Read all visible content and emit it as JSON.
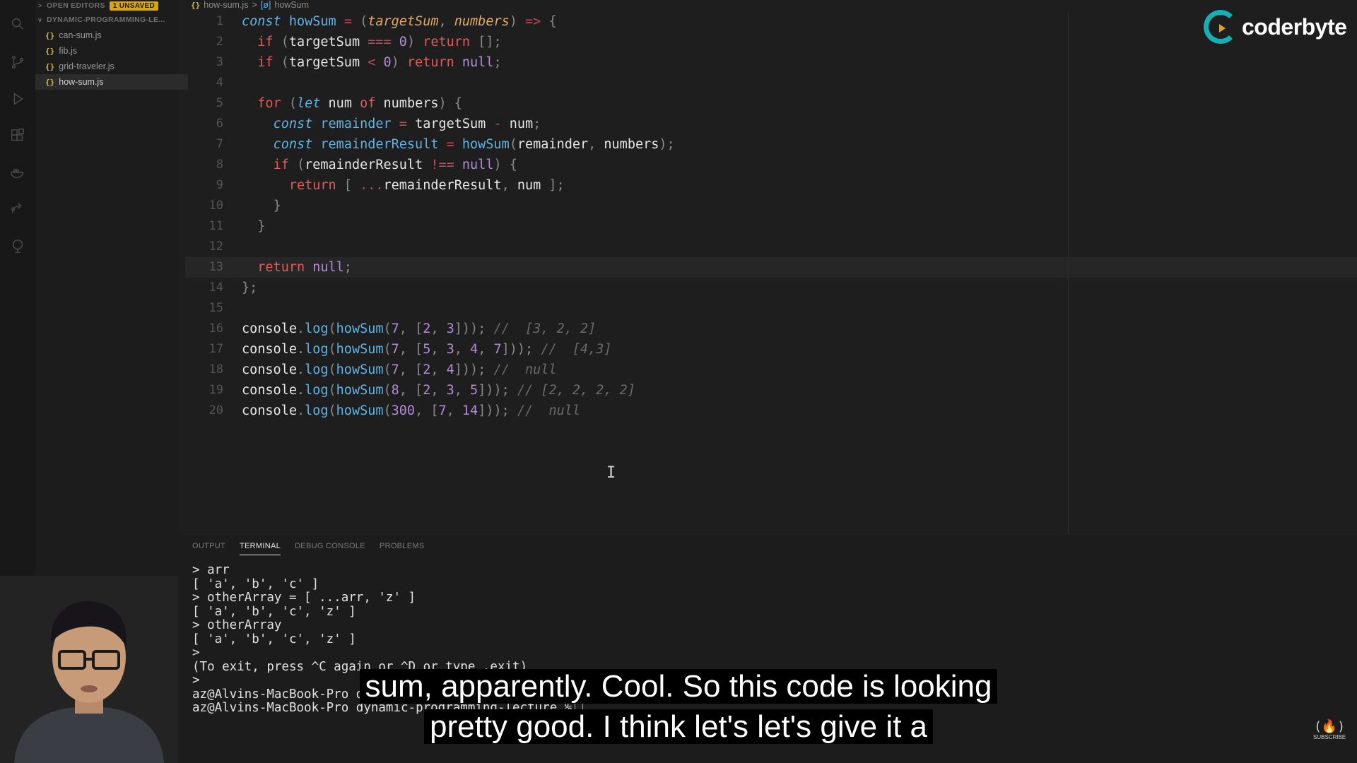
{
  "sidebar": {
    "open_editors_label": "OPEN EDITORS",
    "unsaved_badge": "1 UNSAVED",
    "folder_label": "DYNAMIC-PROGRAMMING-LE...",
    "file_icon": "{}",
    "files": [
      {
        "name": "can-sum.js"
      },
      {
        "name": "fib.js"
      },
      {
        "name": "grid-traveler.js"
      },
      {
        "name": "how-sum.js",
        "active": true
      }
    ]
  },
  "breadcrumb": {
    "file_icon": "{}",
    "file": "how-sum.js",
    "separator": ">",
    "symbol_icon": "[ø]",
    "symbol": "howSum"
  },
  "editor": {
    "current_line": 13,
    "lines": [
      [
        [
          "kw-i",
          "const"
        ],
        [
          "id",
          " "
        ],
        [
          "fn",
          "howSum"
        ],
        [
          "id",
          " "
        ],
        [
          "op",
          "="
        ],
        [
          "id",
          " "
        ],
        [
          "punc",
          "("
        ],
        [
          "param",
          "targetSum"
        ],
        [
          "punc",
          ", "
        ],
        [
          "param",
          "numbers"
        ],
        [
          "punc",
          ")"
        ],
        [
          "id",
          " "
        ],
        [
          "op",
          "=>"
        ],
        [
          "id",
          " "
        ],
        [
          "punc",
          "{"
        ]
      ],
      [
        [
          "id",
          "  "
        ],
        [
          "kw",
          "if"
        ],
        [
          "id",
          " "
        ],
        [
          "punc",
          "("
        ],
        [
          "id",
          "targetSum "
        ],
        [
          "op",
          "==="
        ],
        [
          "id",
          " "
        ],
        [
          "num",
          "0"
        ],
        [
          "punc",
          ")"
        ],
        [
          "id",
          " "
        ],
        [
          "kw",
          "return"
        ],
        [
          "id",
          " "
        ],
        [
          "punc",
          "[];"
        ]
      ],
      [
        [
          "id",
          "  "
        ],
        [
          "kw",
          "if"
        ],
        [
          "id",
          " "
        ],
        [
          "punc",
          "("
        ],
        [
          "id",
          "targetSum "
        ],
        [
          "op",
          "<"
        ],
        [
          "id",
          " "
        ],
        [
          "num",
          "0"
        ],
        [
          "punc",
          ")"
        ],
        [
          "id",
          " "
        ],
        [
          "kw",
          "return"
        ],
        [
          "id",
          " "
        ],
        [
          "lit",
          "null"
        ],
        [
          "punc",
          ";"
        ]
      ],
      [],
      [
        [
          "id",
          "  "
        ],
        [
          "kw",
          "for"
        ],
        [
          "id",
          " "
        ],
        [
          "punc",
          "("
        ],
        [
          "kw-i",
          "let"
        ],
        [
          "id",
          " num "
        ],
        [
          "kw",
          "of"
        ],
        [
          "id",
          " numbers"
        ],
        [
          "punc",
          ")"
        ],
        [
          "id",
          " "
        ],
        [
          "punc",
          "{"
        ]
      ],
      [
        [
          "id",
          "    "
        ],
        [
          "kw-i",
          "const"
        ],
        [
          "id",
          " "
        ],
        [
          "fn",
          "remainder"
        ],
        [
          "id",
          " "
        ],
        [
          "op",
          "="
        ],
        [
          "id",
          " targetSum "
        ],
        [
          "op",
          "-"
        ],
        [
          "id",
          " num"
        ],
        [
          "punc",
          ";"
        ]
      ],
      [
        [
          "id",
          "    "
        ],
        [
          "kw-i",
          "const"
        ],
        [
          "id",
          " "
        ],
        [
          "fn",
          "remainderResult"
        ],
        [
          "id",
          " "
        ],
        [
          "op",
          "="
        ],
        [
          "id",
          " "
        ],
        [
          "fn",
          "howSum"
        ],
        [
          "punc",
          "("
        ],
        [
          "id",
          "remainder"
        ],
        [
          "punc",
          ", "
        ],
        [
          "id",
          "numbers"
        ],
        [
          "punc",
          ");"
        ]
      ],
      [
        [
          "id",
          "    "
        ],
        [
          "kw",
          "if"
        ],
        [
          "id",
          " "
        ],
        [
          "punc",
          "("
        ],
        [
          "id",
          "remainderResult "
        ],
        [
          "op",
          "!=="
        ],
        [
          "id",
          " "
        ],
        [
          "lit",
          "null"
        ],
        [
          "punc",
          ")"
        ],
        [
          "id",
          " "
        ],
        [
          "punc",
          "{"
        ]
      ],
      [
        [
          "id",
          "      "
        ],
        [
          "kw",
          "return"
        ],
        [
          "id",
          " "
        ],
        [
          "punc",
          "[ "
        ],
        [
          "op",
          "..."
        ],
        [
          "id",
          "remainderResult"
        ],
        [
          "punc",
          ", "
        ],
        [
          "id",
          "num "
        ],
        [
          "punc",
          "];"
        ]
      ],
      [
        [
          "id",
          "    "
        ],
        [
          "punc",
          "}"
        ]
      ],
      [
        [
          "id",
          "  "
        ],
        [
          "punc",
          "}"
        ]
      ],
      [],
      [
        [
          "id",
          "  "
        ],
        [
          "kw",
          "return"
        ],
        [
          "id",
          " "
        ],
        [
          "lit",
          "null"
        ],
        [
          "punc",
          ";"
        ]
      ],
      [
        [
          "punc",
          "};"
        ]
      ],
      [],
      [
        [
          "id",
          "console"
        ],
        [
          "punc",
          "."
        ],
        [
          "fn",
          "log"
        ],
        [
          "punc",
          "("
        ],
        [
          "fn",
          "howSum"
        ],
        [
          "punc",
          "("
        ],
        [
          "num",
          "7"
        ],
        [
          "punc",
          ", ["
        ],
        [
          "num",
          "2"
        ],
        [
          "punc",
          ", "
        ],
        [
          "num",
          "3"
        ],
        [
          "punc",
          "]));"
        ],
        [
          "id",
          " "
        ],
        [
          "cmt",
          "//  [3, 2, 2]"
        ]
      ],
      [
        [
          "id",
          "console"
        ],
        [
          "punc",
          "."
        ],
        [
          "fn",
          "log"
        ],
        [
          "punc",
          "("
        ],
        [
          "fn",
          "howSum"
        ],
        [
          "punc",
          "("
        ],
        [
          "num",
          "7"
        ],
        [
          "punc",
          ", ["
        ],
        [
          "num",
          "5"
        ],
        [
          "punc",
          ", "
        ],
        [
          "num",
          "3"
        ],
        [
          "punc",
          ", "
        ],
        [
          "num",
          "4"
        ],
        [
          "punc",
          ", "
        ],
        [
          "num",
          "7"
        ],
        [
          "punc",
          "]));"
        ],
        [
          "id",
          " "
        ],
        [
          "cmt",
          "//  [4,3]"
        ]
      ],
      [
        [
          "id",
          "console"
        ],
        [
          "punc",
          "."
        ],
        [
          "fn",
          "log"
        ],
        [
          "punc",
          "("
        ],
        [
          "fn",
          "howSum"
        ],
        [
          "punc",
          "("
        ],
        [
          "num",
          "7"
        ],
        [
          "punc",
          ", ["
        ],
        [
          "num",
          "2"
        ],
        [
          "punc",
          ", "
        ],
        [
          "num",
          "4"
        ],
        [
          "punc",
          "]));"
        ],
        [
          "id",
          " "
        ],
        [
          "cmt",
          "//  null"
        ]
      ],
      [
        [
          "id",
          "console"
        ],
        [
          "punc",
          "."
        ],
        [
          "fn",
          "log"
        ],
        [
          "punc",
          "("
        ],
        [
          "fn",
          "howSum"
        ],
        [
          "punc",
          "("
        ],
        [
          "num",
          "8"
        ],
        [
          "punc",
          ", ["
        ],
        [
          "num",
          "2"
        ],
        [
          "punc",
          ", "
        ],
        [
          "num",
          "3"
        ],
        [
          "punc",
          ", "
        ],
        [
          "num",
          "5"
        ],
        [
          "punc",
          "]));"
        ],
        [
          "id",
          " "
        ],
        [
          "cmt",
          "// [2, 2, 2, 2]"
        ]
      ],
      [
        [
          "id",
          "console"
        ],
        [
          "punc",
          "."
        ],
        [
          "fn",
          "log"
        ],
        [
          "punc",
          "("
        ],
        [
          "fn",
          "howSum"
        ],
        [
          "punc",
          "("
        ],
        [
          "num",
          "300"
        ],
        [
          "punc",
          ", ["
        ],
        [
          "num",
          "7"
        ],
        [
          "punc",
          ", "
        ],
        [
          "num",
          "14"
        ],
        [
          "punc",
          "]));"
        ],
        [
          "id",
          " "
        ],
        [
          "cmt",
          "//  null"
        ]
      ]
    ]
  },
  "logo": {
    "text": "coderbyte",
    "color": "#14b0b8"
  },
  "panel": {
    "tabs": [
      {
        "label": "OUTPUT"
      },
      {
        "label": "TERMINAL",
        "active": true
      },
      {
        "label": "DEBUG CONSOLE"
      },
      {
        "label": "PROBLEMS"
      }
    ],
    "terminal_lines": [
      "> arr",
      "[ 'a', 'b', 'c' ]",
      "> otherArray = [ ...arr, 'z' ]",
      "[ 'a', 'b', 'c', 'z' ]",
      "> otherArray",
      "[ 'a', 'b', 'c', 'z' ]",
      ">",
      "(To exit, press ^C again or ^D or type .exit)",
      ">",
      "az@Alvins-MacBook-Pro dynamic-programming-lecture %",
      "az@Alvins-MacBook-Pro dynamic-programming-lecture %"
    ]
  },
  "subtitles": [
    "sum, apparently. Cool. So this code is looking",
    "pretty good. I think let's let's give it a"
  ],
  "fcc_logo": {
    "glyph": "(🔥)",
    "label": "SUBSCRIBE"
  }
}
